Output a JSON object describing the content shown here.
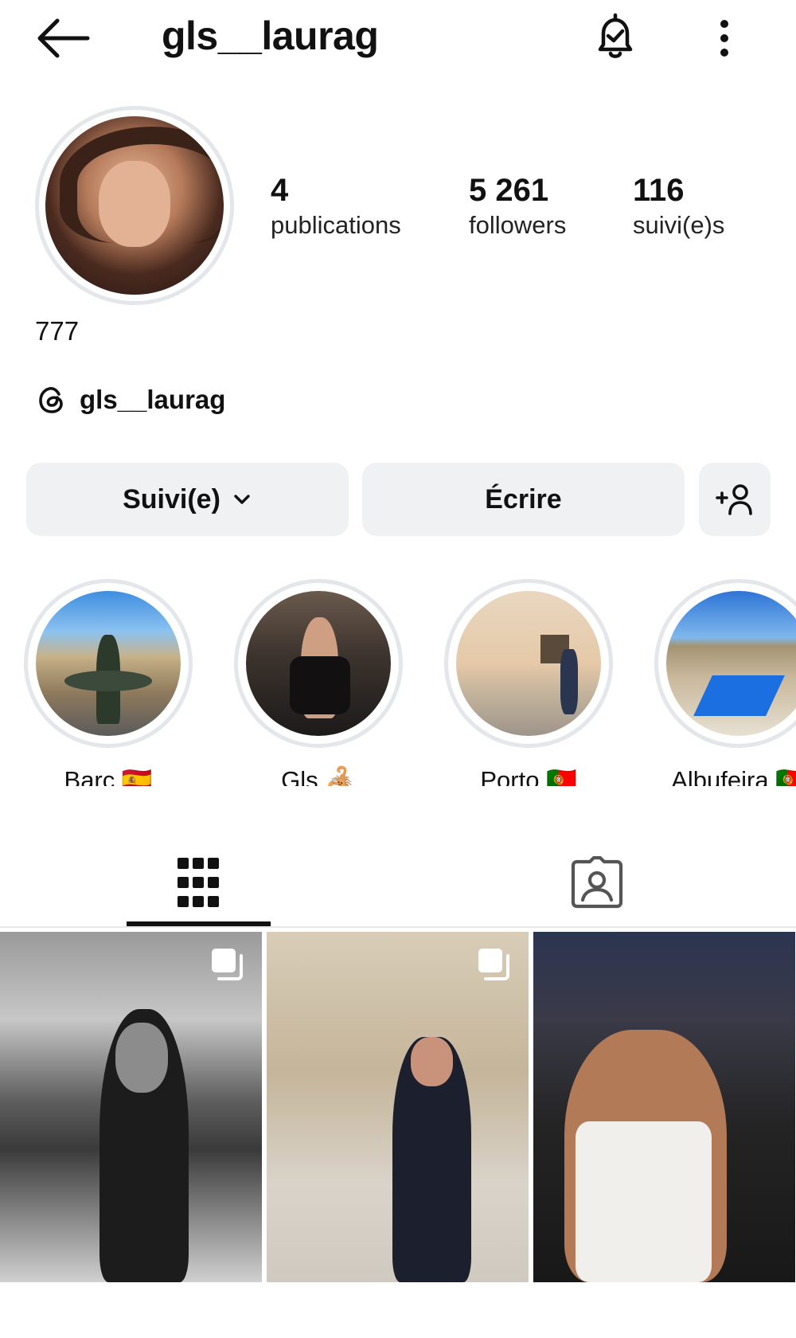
{
  "header": {
    "username": "gls__laurag",
    "back_icon": "arrow-left-icon",
    "notification_icon": "bell-check-icon",
    "more_icon": "more-vertical-icon"
  },
  "profile": {
    "stats": [
      {
        "value": "4",
        "label": "publications"
      },
      {
        "value": "5 261",
        "label": "followers"
      },
      {
        "value": "116",
        "label": "suivi(e)s"
      }
    ],
    "bio": "777",
    "threads_handle": "gls__laurag"
  },
  "actions": {
    "follow_label": "Suivi(e)",
    "message_label": "Écrire",
    "add_user_icon": "add-user-icon"
  },
  "highlights": [
    {
      "label": "Barc 🇪🇸"
    },
    {
      "label": "Gls 🦂"
    },
    {
      "label": "Porto 🇵🇹"
    },
    {
      "label": "Albufeira 🇵🇹"
    }
  ],
  "tabs": [
    {
      "icon": "grid-icon",
      "active": true
    },
    {
      "icon": "tagged-icon",
      "active": false
    }
  ],
  "posts": [
    {
      "multi": true
    },
    {
      "multi": true
    },
    {
      "multi": false
    }
  ]
}
